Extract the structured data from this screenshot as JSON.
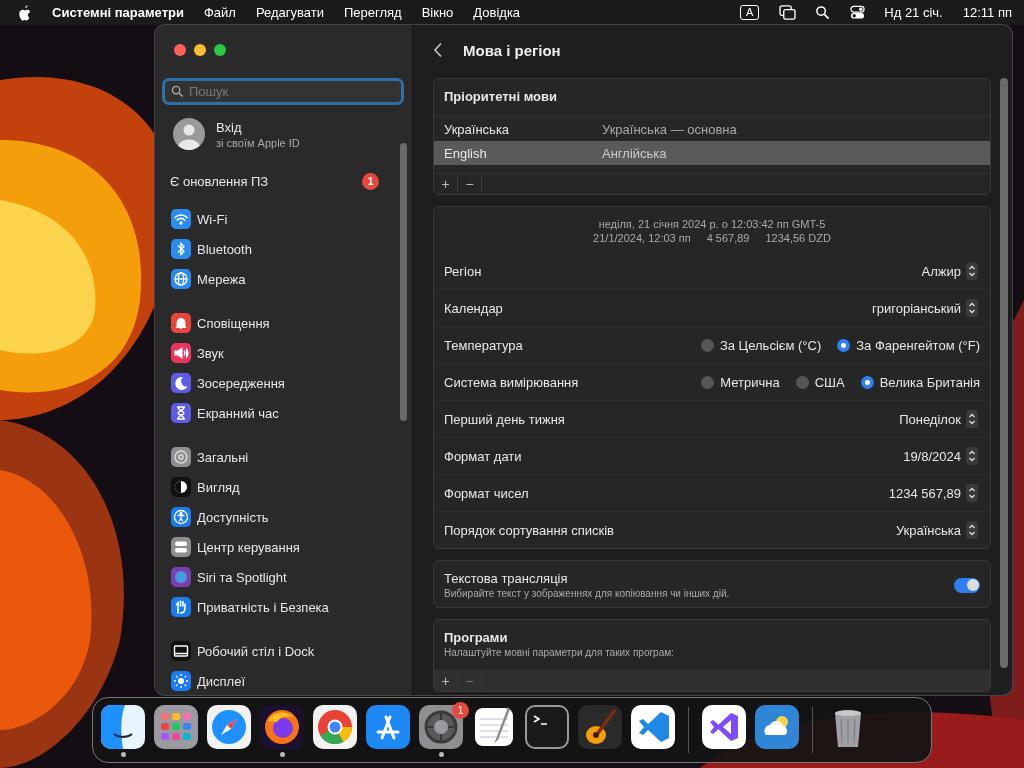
{
  "menu_bar": {
    "app_name": "Системні параметри",
    "menus": [
      "Файл",
      "Редагувати",
      "Перегляд",
      "Вікно",
      "Довідка"
    ],
    "input_source": "A",
    "date": "Нд 21 січ.",
    "time": "12:11 пп"
  },
  "sidebar": {
    "search": {
      "placeholder": "Пошук"
    },
    "account": {
      "title": "Вхід",
      "subtitle": "зі своїм Apple ID"
    },
    "update": {
      "label": "Є оновлення ПЗ",
      "badge": "1"
    },
    "groups": [
      {
        "items": [
          {
            "label": "Wi-Fi",
            "kind": "wifi",
            "color": "#2a8cf0"
          },
          {
            "label": "Bluetooth",
            "kind": "bluetooth",
            "color": "#2a8cf0"
          },
          {
            "label": "Мережа",
            "kind": "globe",
            "color": "#2a8cf0"
          }
        ]
      },
      {
        "items": [
          {
            "label": "Сповіщення",
            "kind": "bell",
            "color": "#e8453c"
          },
          {
            "label": "Звук",
            "kind": "speaker",
            "color": "#e8365f"
          },
          {
            "label": "Зосередження",
            "kind": "moon",
            "color": "#5e5ce6"
          },
          {
            "label": "Екранний час",
            "kind": "hourglass",
            "color": "#5e5ce6"
          }
        ]
      },
      {
        "items": [
          {
            "label": "Загальні",
            "kind": "gear",
            "color": "#8e8e93"
          },
          {
            "label": "Вигляд",
            "kind": "appearance",
            "color": "#111111"
          },
          {
            "label": "Доступність",
            "kind": "accessibility",
            "color": "#1a7cf0"
          },
          {
            "label": "Центр керування",
            "kind": "toggles",
            "color": "#8e8e93"
          },
          {
            "label": "Siri та Spotlight",
            "kind": "siri",
            "color": "#7a3fb0"
          },
          {
            "label": "Приватність і Безпека",
            "kind": "hand",
            "color": "#1a7cf0"
          }
        ]
      },
      {
        "items": [
          {
            "label": "Робочий стіл і Dock",
            "kind": "dock",
            "color": "#111111"
          },
          {
            "label": "Дисплеї",
            "kind": "sun",
            "color": "#1a7cf0"
          }
        ]
      }
    ]
  },
  "page": {
    "title": "Мова і регіон",
    "languages": {
      "title": "Пріоритетні мови",
      "rows": [
        {
          "name": "Українська",
          "note": "Українська — основна",
          "selected": false
        },
        {
          "name": "English",
          "note": "Англійська",
          "selected": true
        }
      ],
      "buttons": [
        "+",
        "−"
      ]
    },
    "formats": {
      "preview_line_1": "неділя, 21 січня 2024 р. о 12:03:42 пп GMT-5",
      "preview_line_2": [
        "21/1/2024, 12:03 пп",
        "4 567,89",
        "1234,56 DZD"
      ],
      "rows": [
        {
          "kind": "popup",
          "label": "Регіон",
          "value": "Алжир"
        },
        {
          "kind": "popup",
          "label": "Календар",
          "value": "григоріанський"
        },
        {
          "kind": "radio",
          "label": "Температура",
          "options": [
            {
              "label": "За Цельсієм (°C)",
              "selected": false
            },
            {
              "label": "За Фаренгейтом (°F)",
              "selected": true
            }
          ]
        },
        {
          "kind": "radio",
          "label": "Система вимірювання",
          "options": [
            {
              "label": "Метрична",
              "selected": false
            },
            {
              "label": "США",
              "selected": false
            },
            {
              "label": "Велика Британія",
              "selected": true
            }
          ]
        },
        {
          "kind": "popup",
          "label": "Перший день тижня",
          "value": "Понеділок"
        },
        {
          "kind": "popup",
          "label": "Формат дати",
          "value": "19/8/2024"
        },
        {
          "kind": "popup",
          "label": "Формат чисел",
          "value": "1234 567,89"
        },
        {
          "kind": "popup",
          "label": "Порядок сортування списків",
          "value": "Українська"
        }
      ]
    },
    "live_text": {
      "title": "Текстова трансляція",
      "subtitle": "Вибирайте текст у зображеннях для копіювання чи інших дій.",
      "on": true
    },
    "apps": {
      "title": "Програми",
      "subtitle": "Налаштуйте мовні параметри для таких програм:",
      "buttons": [
        "+",
        "−"
      ]
    }
  },
  "dock": [
    {
      "kind": "finder",
      "running": true
    },
    {
      "kind": "launchpad",
      "running": false
    },
    {
      "kind": "safari",
      "running": false
    },
    {
      "kind": "firefox",
      "running": true
    },
    {
      "kind": "chrome",
      "running": false
    },
    {
      "kind": "appstore",
      "running": false
    },
    {
      "kind": "settings",
      "running": true,
      "badge": "1"
    },
    {
      "kind": "textedit",
      "running": false
    },
    {
      "kind": "terminal",
      "running": false
    },
    {
      "kind": "garageband",
      "running": false
    },
    {
      "kind": "vscode",
      "running": false
    },
    {
      "kind": "separator"
    },
    {
      "kind": "visualstudio",
      "running": false
    },
    {
      "kind": "weather",
      "running": false
    },
    {
      "kind": "separator"
    },
    {
      "kind": "trash",
      "running": false
    }
  ]
}
